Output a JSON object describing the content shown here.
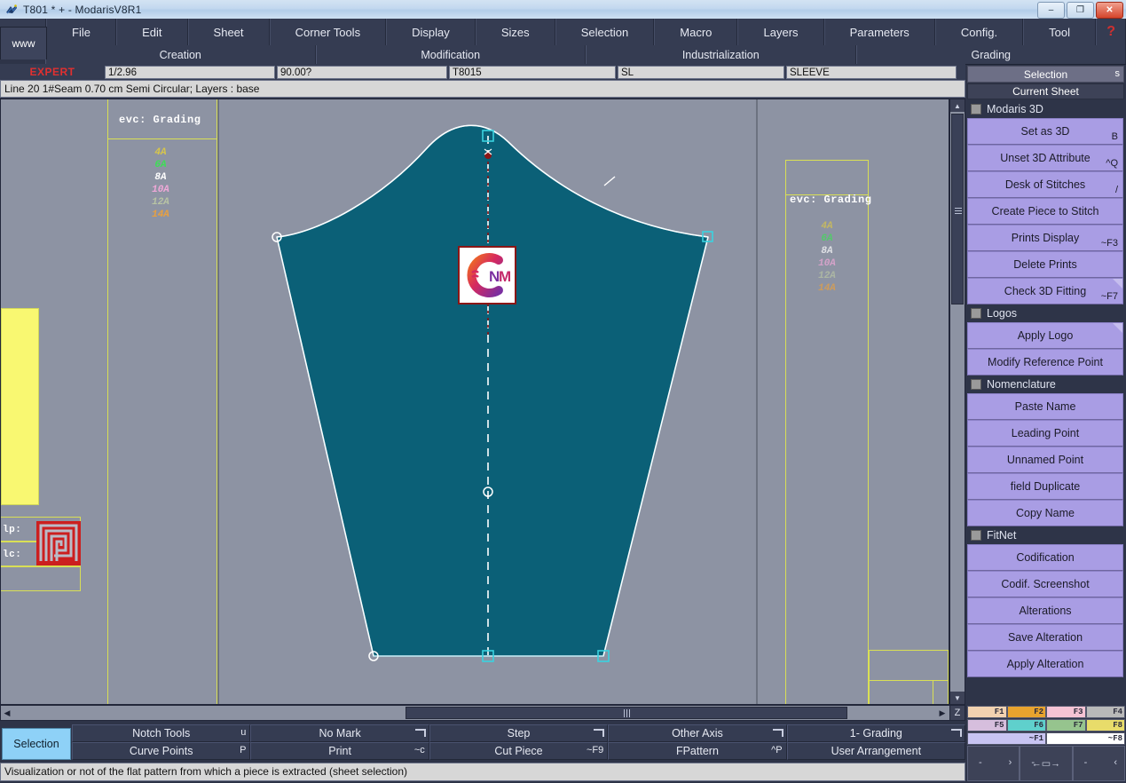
{
  "window": {
    "title": "T801 * + - ModarisV8R1",
    "minimize_label": "–",
    "restore_label": "❐",
    "close_label": "✕"
  },
  "menubar": {
    "www_tab": "www",
    "items": [
      {
        "label": "File"
      },
      {
        "label": "Edit"
      },
      {
        "label": "Sheet"
      },
      {
        "label": "Corner Tools"
      },
      {
        "label": "Display"
      },
      {
        "label": "Sizes"
      },
      {
        "label": "Selection"
      },
      {
        "label": "Macro"
      },
      {
        "label": "Layers"
      },
      {
        "label": "Parameters"
      },
      {
        "label": "Config."
      },
      {
        "label": "Tool"
      }
    ],
    "help_label": "?"
  },
  "groupbar": {
    "items": [
      {
        "label": "Creation"
      },
      {
        "label": "Modification"
      },
      {
        "label": "Industrialization"
      },
      {
        "label": "Grading"
      }
    ]
  },
  "fieldrow": {
    "mode_label": "EXPERT",
    "scale": "1/2.96",
    "angle": "90.00?",
    "model": "T8015",
    "code": "SL",
    "name": "SLEEVE"
  },
  "infoline": {
    "text": "Line 20 1#Seam 0.70 cm Semi Circular;    Layers :  base"
  },
  "right_header": {
    "selection_label": "Selection",
    "selection_key": "s",
    "current_sheet_label": "Current Sheet"
  },
  "right_panel": {
    "items": [
      {
        "type": "check",
        "label": "Modaris 3D"
      },
      {
        "type": "button",
        "label": "Set as 3D",
        "key": "B",
        "fold": false
      },
      {
        "type": "button",
        "label": "Unset 3D Attribute",
        "key": "^Q",
        "fold": false
      },
      {
        "type": "button",
        "label": "Desk of Stitches",
        "key": "/",
        "fold": false
      },
      {
        "type": "button",
        "label": "Create Piece to Stitch",
        "key": "",
        "fold": false
      },
      {
        "type": "button",
        "label": "Prints Display",
        "key": "~F3",
        "fold": false
      },
      {
        "type": "button",
        "label": "Delete Prints",
        "key": "",
        "fold": false
      },
      {
        "type": "button",
        "label": "Check 3D Fitting",
        "key": "~F7",
        "fold": true
      },
      {
        "type": "check",
        "label": "Logos"
      },
      {
        "type": "button",
        "label": "Apply Logo",
        "key": "",
        "fold": true
      },
      {
        "type": "button",
        "label": "Modify Reference Point",
        "key": "",
        "fold": false
      },
      {
        "type": "check",
        "label": "Nomenclature"
      },
      {
        "type": "button",
        "label": "Paste Name",
        "key": "",
        "fold": false
      },
      {
        "type": "button",
        "label": "Leading Point",
        "key": "",
        "fold": false
      },
      {
        "type": "button",
        "label": "Unnamed Point",
        "key": "",
        "fold": false
      },
      {
        "type": "button",
        "label": "field Duplicate",
        "key": "",
        "fold": false
      },
      {
        "type": "button",
        "label": "Copy Name",
        "key": "",
        "fold": false
      },
      {
        "type": "check",
        "label": "FitNet"
      },
      {
        "type": "button",
        "label": "Codification",
        "key": "",
        "fold": false
      },
      {
        "type": "button",
        "label": "Codif. Screenshot",
        "key": "",
        "fold": false
      },
      {
        "type": "button",
        "label": "Alterations",
        "key": "",
        "fold": false
      },
      {
        "type": "button",
        "label": "Save Alteration",
        "key": "",
        "fold": false
      },
      {
        "type": "button",
        "label": "Apply Alteration",
        "key": "",
        "fold": false
      }
    ]
  },
  "canvas": {
    "left_grading_title": "evc: Grading",
    "right_grading_title": "evc: Grading",
    "sizes": [
      {
        "label": "4A",
        "color": "#d8c64a"
      },
      {
        "label": "6A",
        "color": "#3ddf55"
      },
      {
        "label": "8A",
        "color": "#ffffff"
      },
      {
        "label": "10A",
        "color": "#f0a8d8"
      },
      {
        "label": "12A",
        "color": "#b8c4a4"
      },
      {
        "label": "14A",
        "color": "#e8a040"
      }
    ],
    "left_labels": {
      "lp": "lp:",
      "lc": "lc:"
    },
    "piece_fill": "#0b6077",
    "piece_outline": "#e8f3f8",
    "axis_color": "#ffffff",
    "logo_text_n": "N",
    "logo_text_m": "M"
  },
  "scrollbars": {
    "v_up": "▲",
    "v_down": "▼",
    "h_left": "◀",
    "h_right": "▶",
    "z_label": "Z"
  },
  "sizebar": {
    "row1": [
      {
        "label": "F1",
        "color": "#f2d2b0"
      },
      {
        "label": "F2",
        "color": "#e8a32e"
      },
      {
        "label": "F3",
        "color": "#f5c3d4"
      },
      {
        "label": "F4",
        "color": "#b9b9b9"
      }
    ],
    "row2": [
      {
        "label": "F5",
        "color": "#d6bedd"
      },
      {
        "label": "F6",
        "color": "#5fd0cc"
      },
      {
        "label": "F7",
        "color": "#96c48e"
      },
      {
        "label": "F8",
        "color": "#e8dc6a"
      }
    ],
    "row3": [
      {
        "label": "~F1",
        "color": "#c8c4f2"
      },
      {
        "label": "~F8",
        "color": "#ffffff"
      }
    ]
  },
  "bottom_toolbar": {
    "selection_tab": "Selection",
    "row1": [
      {
        "label": "Notch Tools",
        "key": "u",
        "fold": false
      },
      {
        "label": "No Mark",
        "key": "",
        "fold": true
      },
      {
        "label": "Step",
        "key": "",
        "fold": true
      },
      {
        "label": "Other Axis",
        "key": "",
        "fold": true
      },
      {
        "label": "1- Grading",
        "key": "",
        "fold": true
      }
    ],
    "row2": [
      {
        "label": "Curve Points",
        "key": "P",
        "fold": false
      },
      {
        "label": "Print",
        "key": "~c",
        "fold": false
      },
      {
        "label": "Cut Piece",
        "key": "~F9",
        "fold": false
      },
      {
        "label": "FPattern",
        "key": "^P",
        "fold": false
      },
      {
        "label": "User Arrangement",
        "key": "",
        "fold": false
      }
    ]
  },
  "statusbar": {
    "text": "Visualization or not of the flat pattern from which a piece is extracted (sheet selection)"
  },
  "bottom_nav": {
    "cells": [
      {
        "left": "-",
        "right": "›",
        "center": ""
      },
      {
        "left": "-",
        "right": "",
        "center": "←▭→"
      },
      {
        "left": "-",
        "right": "‹",
        "center": ""
      }
    ]
  }
}
